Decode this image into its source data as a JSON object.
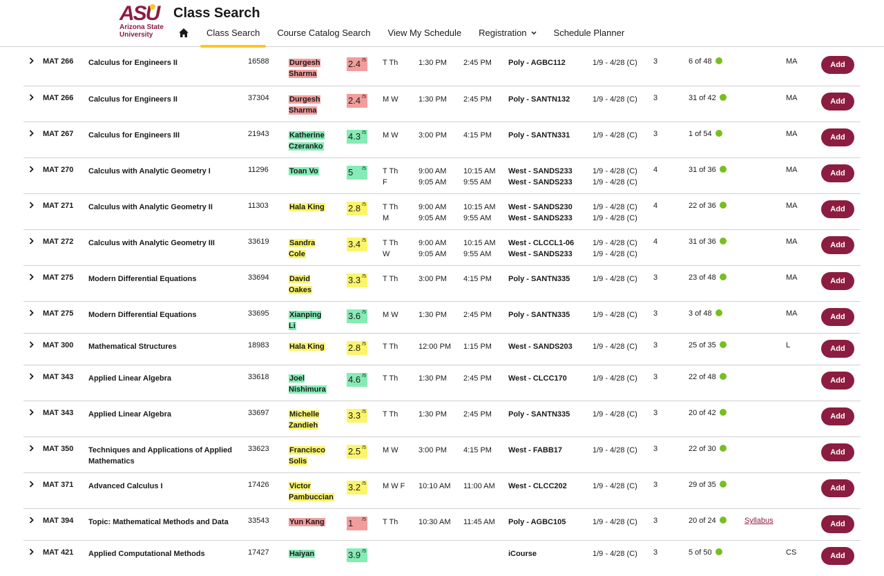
{
  "header": {
    "logo_mark": "ASU",
    "logo_line1": "Arizona State",
    "logo_line2": "University",
    "page_title": "Class Search",
    "nav": {
      "class_search": "Class Search",
      "catalog": "Course Catalog Search",
      "schedule": "View My Schedule",
      "registration": "Registration",
      "planner": "Schedule Planner"
    }
  },
  "rating_suffix": "/5",
  "add_label": "Add",
  "colors": {
    "maroon": "#8c1d40",
    "gold": "#ffc627",
    "rating_low": "#f29d9d",
    "rating_mid": "#fbf56c",
    "rating_high": "#86ebb6",
    "seats_dot": "#78be20"
  },
  "rows": [
    {
      "code": "MAT 266",
      "title": "Calculus for Engineers II",
      "number": "16588",
      "instructor": "Durgesh Sharma",
      "rating": "2.4",
      "rating_color": "red",
      "days": "T Th",
      "days2": "",
      "start": "1:30 PM",
      "start2": "",
      "end": "2:45 PM",
      "end2": "",
      "location": "Poly - AGBC112",
      "location2": "",
      "dates": "1/9 - 4/28 (C)",
      "dates2": "",
      "units": "3",
      "seats": "6 of 48",
      "syllabus": "",
      "gs": "MA",
      "height": 52
    },
    {
      "code": "MAT 266",
      "title": "Calculus for Engineers II",
      "number": "37304",
      "instructor": "Durgesh Sharma",
      "rating": "2.4",
      "rating_color": "red",
      "days": "M W",
      "days2": "",
      "start": "1:30 PM",
      "start2": "",
      "end": "2:45 PM",
      "end2": "",
      "location": "Poly - SANTN132",
      "location2": "",
      "dates": "1/9 - 4/28 (C)",
      "dates2": "",
      "units": "3",
      "seats": "31 of 42",
      "syllabus": "",
      "gs": "MA",
      "height": 52
    },
    {
      "code": "MAT 267",
      "title": "Calculus for Engineers III",
      "number": "21943",
      "instructor": "Katherine Czeranko",
      "rating": "4.3",
      "rating_color": "green",
      "days": "M W",
      "days2": "",
      "start": "3:00 PM",
      "start2": "",
      "end": "4:15 PM",
      "end2": "",
      "location": "Poly - SANTN331",
      "location2": "",
      "dates": "1/9 - 4/28 (C)",
      "dates2": "",
      "units": "3",
      "seats": "1 of 54",
      "syllabus": "",
      "gs": "MA",
      "height": 52
    },
    {
      "code": "MAT 270",
      "title": "Calculus with Analytic Geometry I",
      "number": "11296",
      "instructor": "Toan Vo",
      "rating": "5",
      "rating_color": "green",
      "days": "T Th",
      "days2": "F",
      "start": "9:00 AM",
      "start2": "9:05 AM",
      "end": "10:15 AM",
      "end2": "9:55 AM",
      "location": "West - SANDS233",
      "location2": "West - SANDS233",
      "dates": "1/9 - 4/28 (C)",
      "dates2": "1/9 - 4/28 (C)",
      "units": "4",
      "seats": "31 of 36",
      "syllabus": "",
      "gs": "MA",
      "height": 52
    },
    {
      "code": "MAT 271",
      "title": "Calculus with Analytic Geometry II",
      "number": "11303",
      "instructor": "Hala King",
      "rating": "2.8",
      "rating_color": "yellow",
      "days": "T Th",
      "days2": "M",
      "start": "9:00 AM",
      "start2": "9:05 AM",
      "end": "10:15 AM",
      "end2": "9:55 AM",
      "location": "West - SANDS230",
      "location2": "West - SANDS233",
      "dates": "1/9 - 4/28 (C)",
      "dates2": "1/9 - 4/28 (C)",
      "units": "4",
      "seats": "22 of 36",
      "syllabus": "",
      "gs": "MA",
      "height": 52
    },
    {
      "code": "MAT 272",
      "title": "Calculus with Analytic Geometry III",
      "number": "33619",
      "instructor": "Sandra Cole",
      "rating": "3.4",
      "rating_color": "yellow",
      "days": "T Th",
      "days2": "W",
      "start": "9:00 AM",
      "start2": "9:05 AM",
      "end": "10:15 AM",
      "end2": "9:55 AM",
      "location": "West - CLCCL1-06",
      "location2": "West - SANDS233",
      "dates": "1/9 - 4/28 (C)",
      "dates2": "1/9 - 4/28 (C)",
      "units": "4",
      "seats": "31 of 36",
      "syllabus": "",
      "gs": "MA",
      "height": 52
    },
    {
      "code": "MAT 275",
      "title": "Modern Differential Equations",
      "number": "33694",
      "instructor": "David Oakes",
      "rating": "3.3",
      "rating_color": "yellow",
      "days": "T Th",
      "days2": "",
      "start": "3:00 PM",
      "start2": "",
      "end": "4:15 PM",
      "end2": "",
      "location": "Poly - SANTN335",
      "location2": "",
      "dates": "1/9 - 4/28 (C)",
      "dates2": "",
      "units": "3",
      "seats": "23 of 48",
      "syllabus": "",
      "gs": "MA",
      "height": 52
    },
    {
      "code": "MAT 275",
      "title": "Modern Differential Equations",
      "number": "33695",
      "instructor": "Xianping Li",
      "rating": "3.6",
      "rating_color": "green",
      "days": "M W",
      "days2": "",
      "start": "1:30 PM",
      "start2": "",
      "end": "2:45 PM",
      "end2": "",
      "location": "Poly - SANTN335",
      "location2": "",
      "dates": "1/9 - 4/28 (C)",
      "dates2": "",
      "units": "3",
      "seats": "3 of 48",
      "syllabus": "",
      "gs": "MA",
      "height": 46
    },
    {
      "code": "MAT 300",
      "title": "Mathematical Structures",
      "number": "18983",
      "instructor": "Hala King",
      "rating": "2.8",
      "rating_color": "yellow",
      "days": "T Th",
      "days2": "",
      "start": "12:00 PM",
      "start2": "",
      "end": "1:15 PM",
      "end2": "",
      "location": "West - SANDS203",
      "location2": "",
      "dates": "1/9 - 4/28 (C)",
      "dates2": "",
      "units": "3",
      "seats": "25 of 35",
      "syllabus": "",
      "gs": "L",
      "height": 46
    },
    {
      "code": "MAT 343",
      "title": "Applied Linear Algebra",
      "number": "33618",
      "instructor": "Joel Nishimura",
      "rating": "4.6",
      "rating_color": "green",
      "days": "T Th",
      "days2": "",
      "start": "1:30 PM",
      "start2": "",
      "end": "2:45 PM",
      "end2": "",
      "location": "West - CLCC170",
      "location2": "",
      "dates": "1/9 - 4/28 (C)",
      "dates2": "",
      "units": "3",
      "seats": "22 of 48",
      "syllabus": "",
      "gs": "",
      "height": 52
    },
    {
      "code": "MAT 343",
      "title": "Applied Linear Algebra",
      "number": "33697",
      "instructor": "Michelle Zandieh",
      "rating": "3.3",
      "rating_color": "yellow",
      "days": "T Th",
      "days2": "",
      "start": "1:30 PM",
      "start2": "",
      "end": "2:45 PM",
      "end2": "",
      "location": "Poly - SANTN335",
      "location2": "",
      "dates": "1/9 - 4/28 (C)",
      "dates2": "",
      "units": "3",
      "seats": "20 of 42",
      "syllabus": "",
      "gs": "",
      "height": 52
    },
    {
      "code": "MAT 350",
      "title": "Techniques and Applications of Applied Mathematics",
      "number": "33623",
      "instructor": "Francisco Solis",
      "rating": "2.5",
      "rating_color": "yellow",
      "days": "M W",
      "days2": "",
      "start": "3:00 PM",
      "start2": "",
      "end": "4:15 PM",
      "end2": "",
      "location": "West - FABB17",
      "location2": "",
      "dates": "1/9 - 4/28 (C)",
      "dates2": "",
      "units": "3",
      "seats": "22 of 30",
      "syllabus": "",
      "gs": "",
      "height": 52
    },
    {
      "code": "MAT 371",
      "title": "Advanced Calculus I",
      "number": "17426",
      "instructor": "Victor Pambuccian",
      "rating": "3.2",
      "rating_color": "yellow",
      "days": "M W F",
      "days2": "",
      "start": "10:10 AM",
      "start2": "",
      "end": "11:00 AM",
      "end2": "",
      "location": "West - CLCC202",
      "location2": "",
      "dates": "1/9 - 4/28 (C)",
      "dates2": "",
      "units": "3",
      "seats": "29 of 35",
      "syllabus": "",
      "gs": "",
      "height": 52
    },
    {
      "code": "MAT 394",
      "title": "Topic: Mathematical Methods and Data",
      "number": "33543",
      "instructor": "Yun Kang",
      "rating": "1",
      "rating_color": "red",
      "days": "T Th",
      "days2": "",
      "start": "10:30 AM",
      "start2": "",
      "end": "11:45 AM",
      "end2": "",
      "location": "Poly - AGBC105",
      "location2": "",
      "dates": "1/9 - 4/28 (C)",
      "dates2": "",
      "units": "3",
      "seats": "20 of 24",
      "syllabus": "Syllabus",
      "gs": "",
      "height": 46
    },
    {
      "code": "MAT 421",
      "title": "Applied Computational Methods",
      "number": "17427",
      "instructor": "Haiyan",
      "rating": "3.9",
      "rating_color": "green",
      "days": "",
      "days2": "",
      "start": "",
      "start2": "",
      "end": "",
      "end2": "",
      "location": "iCourse",
      "location2": "",
      "dates": "1/9 - 4/28 (C)",
      "dates2": "",
      "units": "3",
      "seats": "5 of 50",
      "syllabus": "",
      "gs": "CS",
      "height": 52
    }
  ]
}
